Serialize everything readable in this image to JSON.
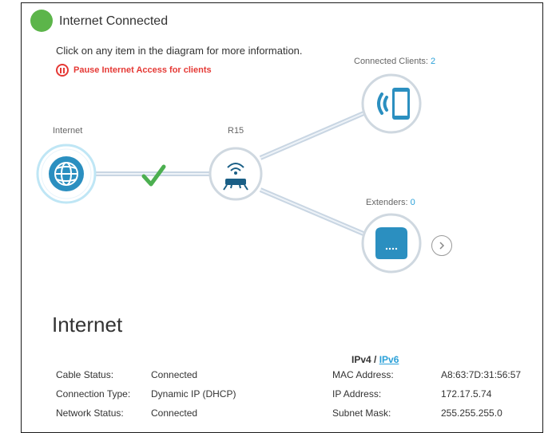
{
  "status": {
    "title": "Internet Connected",
    "dot_color": "#5cb54a"
  },
  "hint": "Click on any item in the diagram for more information.",
  "pause": {
    "label": "Pause Internet Access for clients",
    "icon": "pause-circle-icon",
    "color": "#e53935"
  },
  "diagram": {
    "internet": {
      "label": "Internet",
      "icon": "globe-icon"
    },
    "router": {
      "label": "R15",
      "icon": "router-icon",
      "link_status": "check-icon"
    },
    "clients": {
      "label": "Connected Clients: ",
      "count": "2",
      "icon": "phone-icon"
    },
    "extenders": {
      "label": "Extenders: ",
      "count": "0",
      "icon": "extender-icon"
    },
    "next_icon": "chevron-right-icon",
    "accent": "#2aa0d8"
  },
  "section": {
    "title": "Internet",
    "ipv4": "IPv4",
    "sep": " / ",
    "ipv6": "IPv6"
  },
  "left_info": [
    {
      "key": "Cable Status:",
      "value": "Connected"
    },
    {
      "key": "Connection Type:",
      "value": "Dynamic IP (DHCP)"
    },
    {
      "key": "Network Status:",
      "value": "Connected"
    }
  ],
  "right_info": [
    {
      "key": "MAC Address:",
      "value": "A8:63:7D:31:56:57"
    },
    {
      "key": "IP Address:",
      "value": "172.17.5.74"
    },
    {
      "key": "Subnet Mask:",
      "value": "255.255.255.0"
    }
  ]
}
